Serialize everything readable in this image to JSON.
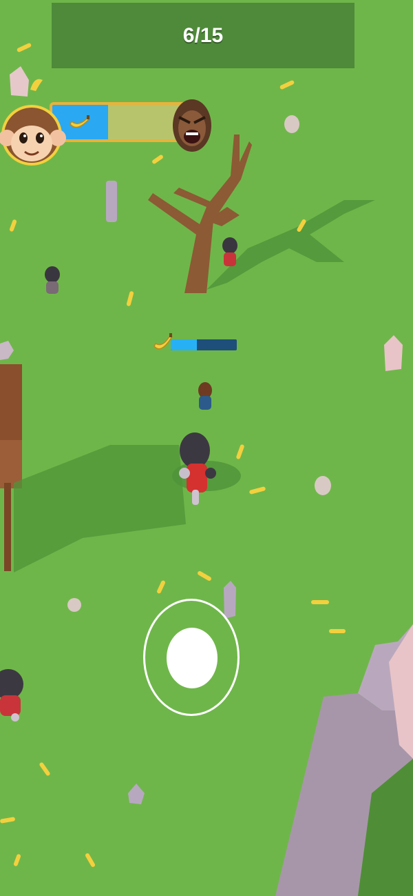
{
  "hud": {
    "counter_text": "6/15",
    "banana_progress": 0.42,
    "player_avatar_icon": "monkey-face-icon",
    "rival_avatar_icon": "gorilla-face-icon",
    "progress_icon": "banana-icon"
  },
  "collect_bar": {
    "icon": "banana-icon",
    "progress": 0.4
  },
  "joystick": {
    "ring_icon": "joystick-ring",
    "knob_icon": "joystick-knob"
  },
  "colors": {
    "grass": "#6fb64a",
    "panel": "#4e8a3a",
    "progress_fill": "#2aa8f2",
    "progress_track": "#b8c46c",
    "progress_border": "#e9b23a",
    "banana": "#f3d03e"
  }
}
